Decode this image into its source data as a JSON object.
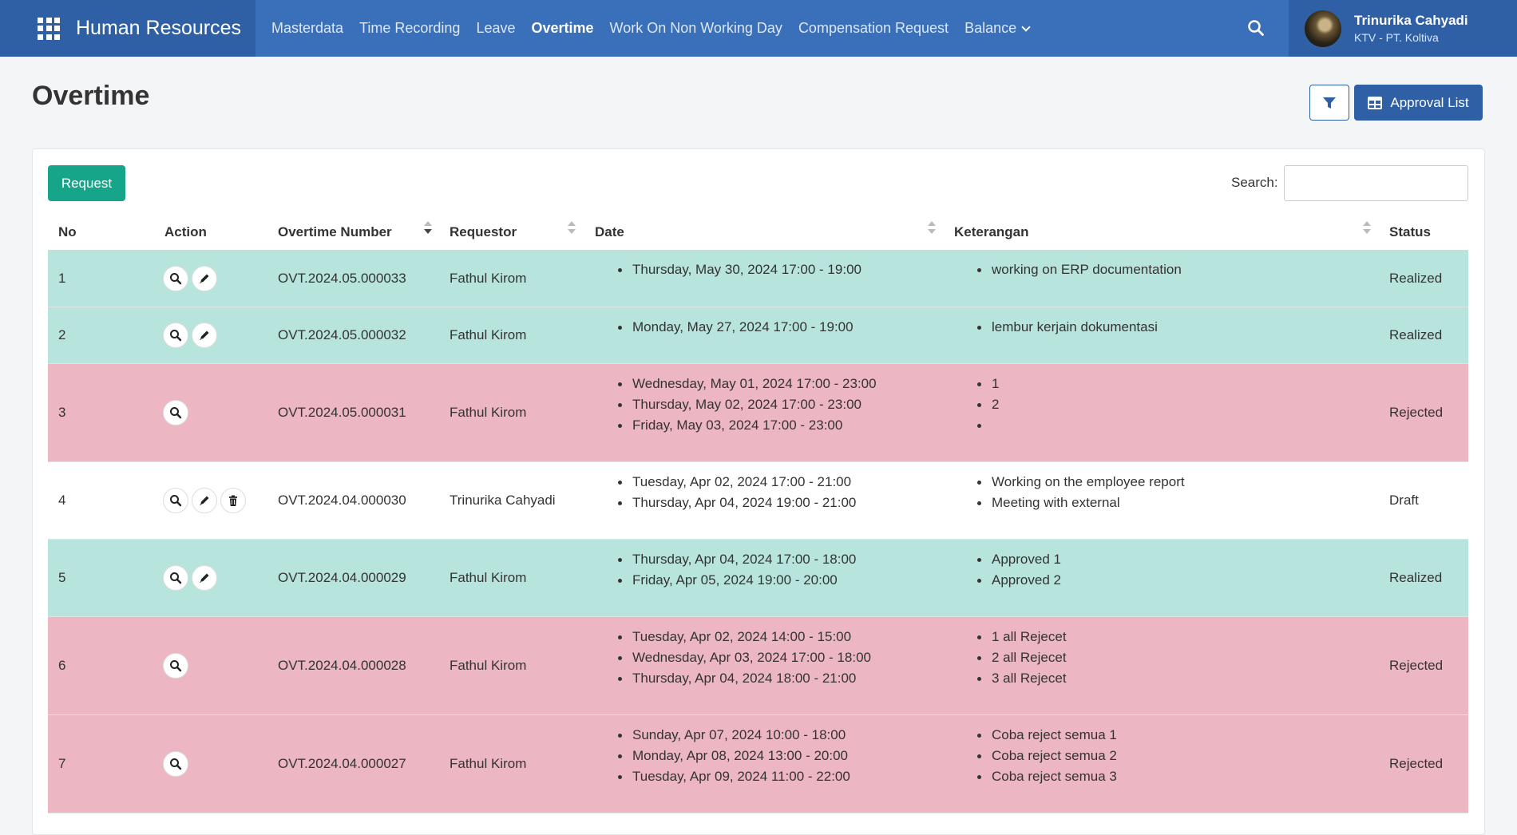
{
  "app": {
    "title": "Human Resources"
  },
  "nav": {
    "items": [
      {
        "label": "Masterdata"
      },
      {
        "label": "Time Recording"
      },
      {
        "label": "Leave"
      },
      {
        "label": "Overtime"
      },
      {
        "label": "Work On Non Working Day"
      },
      {
        "label": "Compensation Request"
      },
      {
        "label": "Balance"
      }
    ],
    "active": "Overtime"
  },
  "user": {
    "name": "Trinurika Cahyadi",
    "company": "KTV - PT. Koltiva"
  },
  "page": {
    "title": "Overtime",
    "approval_list_label": "Approval List"
  },
  "toolbar": {
    "request_label": "Request",
    "search_label": "Search:",
    "search_value": ""
  },
  "table": {
    "columns": [
      "No",
      "Action",
      "Overtime Number",
      "Requestor",
      "Date",
      "Keterangan",
      "Status"
    ],
    "rows": [
      {
        "no": "1",
        "actions": [
          "view",
          "edit"
        ],
        "number": "OVT.2024.05.000033",
        "requestor": "Fathul Kirom",
        "dates": [
          "Thursday, May 30, 2024 17:00 - 19:00"
        ],
        "notes": [
          "working on ERP documentation"
        ],
        "status": "Realized",
        "color": "#b8e4de"
      },
      {
        "no": "2",
        "actions": [
          "view",
          "edit"
        ],
        "number": "OVT.2024.05.000032",
        "requestor": "Fathul Kirom",
        "dates": [
          "Monday, May 27, 2024 17:00 - 19:00"
        ],
        "notes": [
          "lembur kerjain dokumentasi"
        ],
        "status": "Realized",
        "color": "#b8e4de"
      },
      {
        "no": "3",
        "actions": [
          "view"
        ],
        "number": "OVT.2024.05.000031",
        "requestor": "Fathul Kirom",
        "dates": [
          "Wednesday, May 01, 2024 17:00 - 23:00",
          "Thursday, May 02, 2024 17:00 - 23:00",
          "Friday, May 03, 2024 17:00 - 23:00"
        ],
        "notes": [
          "1",
          "2",
          ""
        ],
        "status": "Rejected",
        "color": "#ecb7c3"
      },
      {
        "no": "4",
        "actions": [
          "view",
          "edit",
          "delete"
        ],
        "number": "OVT.2024.04.000030",
        "requestor": "Trinurika Cahyadi",
        "dates": [
          "Tuesday, Apr 02, 2024 17:00 - 21:00",
          "Thursday, Apr 04, 2024 19:00 - 21:00"
        ],
        "notes": [
          "Working on the employee report",
          "Meeting with external"
        ],
        "status": "Draft",
        "color": "#ffffff"
      },
      {
        "no": "5",
        "actions": [
          "view",
          "edit"
        ],
        "number": "OVT.2024.04.000029",
        "requestor": "Fathul Kirom",
        "dates": [
          "Thursday, Apr 04, 2024 17:00 - 18:00",
          "Friday, Apr 05, 2024 19:00 - 20:00"
        ],
        "notes": [
          "Approved 1",
          "Approved 2"
        ],
        "status": "Realized",
        "color": "#b8e4de"
      },
      {
        "no": "6",
        "actions": [
          "view"
        ],
        "number": "OVT.2024.04.000028",
        "requestor": "Fathul Kirom",
        "dates": [
          "Tuesday, Apr 02, 2024 14:00 - 15:00",
          "Wednesday, Apr 03, 2024 17:00 - 18:00",
          "Thursday, Apr 04, 2024 18:00 - 21:00"
        ],
        "notes": [
          "1 all Rejecet",
          "2 all Rejecet",
          "3 all Rejecet"
        ],
        "status": "Rejected",
        "color": "#ecb7c3"
      },
      {
        "no": "7",
        "actions": [
          "view"
        ],
        "number": "OVT.2024.04.000027",
        "requestor": "Fathul Kirom",
        "dates": [
          "Sunday, Apr 07, 2024 10:00 - 18:00",
          "Monday, Apr 08, 2024 13:00 - 20:00",
          "Tuesday, Apr 09, 2024 11:00 - 22:00"
        ],
        "notes": [
          "Coba reject semua 1",
          "Coba reject semua 2",
          "Coba reject semua 3"
        ],
        "status": "Rejected",
        "color": "#ecb7c3"
      }
    ]
  },
  "colors": {
    "navbar": "#3a6fba",
    "brand": "#2f5fa5",
    "request_button": "#17a589",
    "realized": "#b8e4de",
    "rejected": "#ecb7c3"
  }
}
